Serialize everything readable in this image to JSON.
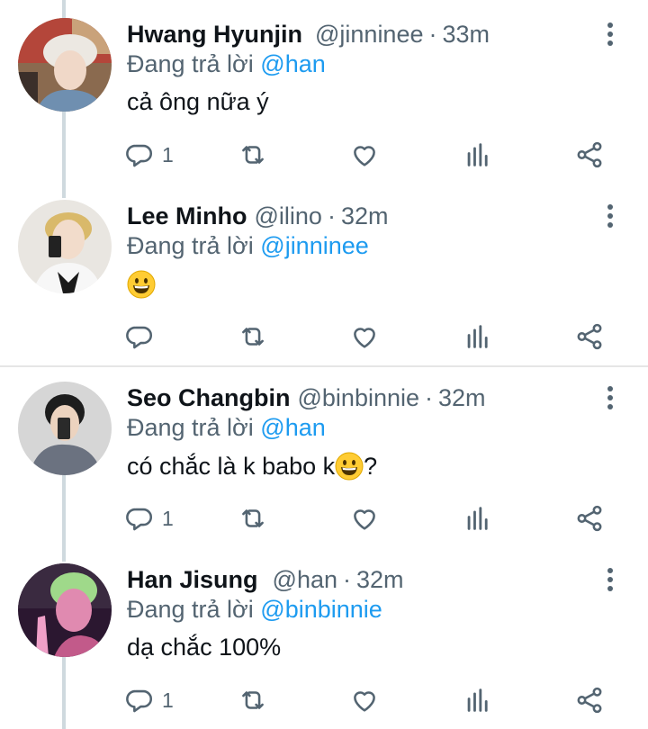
{
  "reply_prefix": "Đang trả lời",
  "tweets": [
    {
      "name": "Hwang Hyunjin",
      "handle": "@jinninee",
      "dot": "·",
      "time": "33m",
      "reply_to": "@han",
      "text": "cả ông nữa ý",
      "reply_count": "1"
    },
    {
      "name": "Lee Minho",
      "handle": "@ilino",
      "dot": "·",
      "time": "32m",
      "reply_to": "@jinninee",
      "text": "",
      "emoji": "grinning-face",
      "reply_count": ""
    },
    {
      "name": "Seo Changbin",
      "handle": "@binbinnie",
      "dot": "·",
      "time": "32m",
      "reply_to": "@han",
      "text": "có chắc là k babo k",
      "emoji": "grinning-face",
      "text_after": "?",
      "reply_count": "1"
    },
    {
      "name": "Han Jisung",
      "handle": "@han",
      "dot": "·",
      "time": "32m",
      "reply_to": "@binbinnie",
      "text": "dạ chắc 100%",
      "reply_count": "1"
    }
  ],
  "icons": {
    "reply": "reply-icon",
    "retweet": "retweet-icon",
    "like": "heart-icon",
    "views": "bar-chart-icon",
    "share": "share-icon",
    "more": "more-vertical-icon"
  },
  "colors": {
    "link": "#1d9bf0",
    "secondary": "#536471",
    "primary": "#0f1419",
    "thread_line": "#cfd9de"
  }
}
